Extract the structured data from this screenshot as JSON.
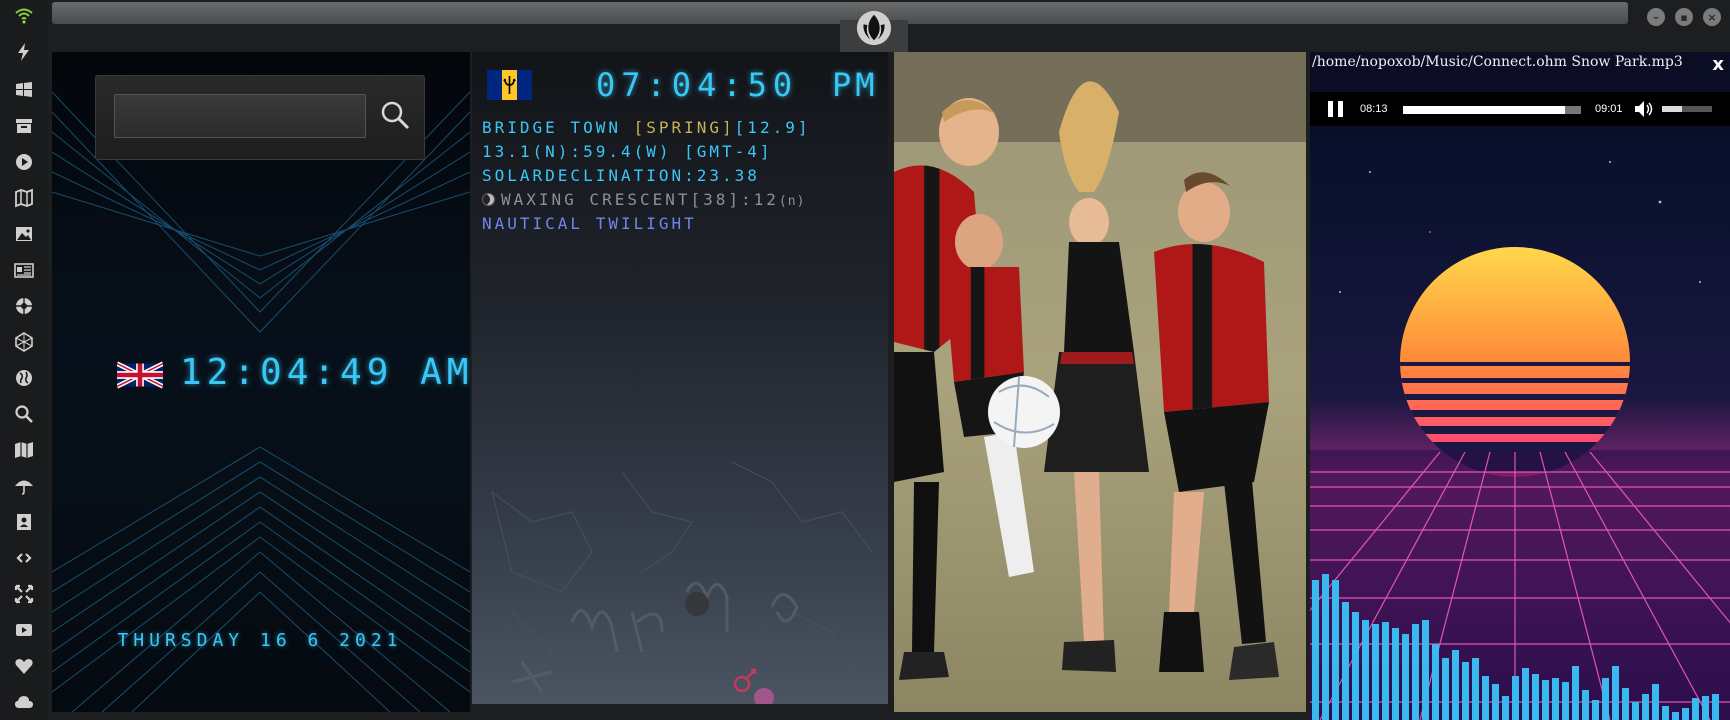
{
  "rail": {
    "icons": [
      "wifi-icon",
      "lightning-icon",
      "windows-icon",
      "archive-icon",
      "play-icon",
      "map-book-icon",
      "image-icon",
      "news-icon",
      "rebel-icon",
      "hexagon-icon",
      "globe-icon",
      "search-icon",
      "map-icon",
      "umbrella-icon",
      "contact-icon",
      "link-icon",
      "expand-icon",
      "youtube-icon",
      "heart-icon",
      "cloud-icon"
    ],
    "accent": "#8fcf3a"
  },
  "uk_clock": {
    "search_placeholder": "",
    "time": "12:04:49",
    "ampm": "AM",
    "date": "THURSDAY 16 6 2021"
  },
  "bridgetown": {
    "time": "07:04:50",
    "ampm": "PM",
    "city": "BRIDGE TOWN",
    "season": "[SPRING]",
    "temp": "[12.9]",
    "coords": "13.1(N):59.4(W) [GMT-4]",
    "solar": "SOLARDECLINATION:23.38",
    "moon": "WAXING CRESCENT[38]:12",
    "moon_suffix": "(n)",
    "twilight": "NAUTICAL TWILIGHT"
  },
  "player": {
    "file_path": "/home/nopoxob/Music/Connect.ohm Snow Park.mp3",
    "close_label": "x",
    "current_time": "08:13",
    "duration": "09:01",
    "progress": 0.91,
    "volume": 0.4
  },
  "colors": {
    "clock_cyan": "#39c8f5",
    "season_gold": "#c9b256",
    "twilight_blue": "#6f86e8"
  }
}
